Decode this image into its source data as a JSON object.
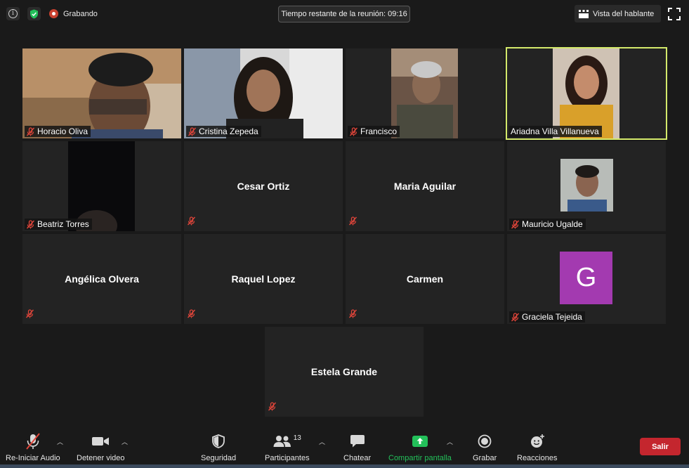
{
  "topbar": {
    "recording_label": "Grabando",
    "timer_text": "Tiempo restante de la reunión: 09:16",
    "view_button": "Vista del hablante"
  },
  "participants": [
    {
      "name": "Horacio Oliva",
      "video": true,
      "muted": true
    },
    {
      "name": "Cristina Zepeda",
      "video": true,
      "muted": true
    },
    {
      "name": "Francisco",
      "video": true,
      "muted": true
    },
    {
      "name": "Ariadna Villa Villanueva",
      "video": true,
      "muted": false,
      "active_speaker": true
    },
    {
      "name": "Beatriz Torres",
      "video": true,
      "muted": true
    },
    {
      "name": "Cesar Ortiz",
      "video": false,
      "muted": true
    },
    {
      "name": "Maria Aguilar",
      "video": false,
      "muted": true
    },
    {
      "name": "Mauricio Ugalde",
      "video": true,
      "muted": true
    },
    {
      "name": "Angélica Olvera",
      "video": false,
      "muted": true
    },
    {
      "name": "Raquel Lopez",
      "video": false,
      "muted": true
    },
    {
      "name": "Carmen",
      "video": false,
      "muted": true
    },
    {
      "name": "Graciela Tejeida",
      "video": false,
      "avatar_letter": "G",
      "avatar_color": "#a33ab0",
      "muted": true
    },
    {
      "name": "Estela Grande",
      "video": false,
      "muted": true
    }
  ],
  "toolbar": {
    "audio": "Re-Iniciar Audio",
    "video": "Detener video",
    "security": "Seguridad",
    "participants": "Participantes",
    "participants_count": "13",
    "chat": "Chatear",
    "share": "Compartir pantalla",
    "record": "Grabar",
    "reactions": "Reacciones",
    "leave": "Salir"
  },
  "colors": {
    "active_speaker_border": "#d4ea6b",
    "leave_button": "#c4262e",
    "share_green": "#23c05a",
    "muted_red": "#e0453a"
  }
}
